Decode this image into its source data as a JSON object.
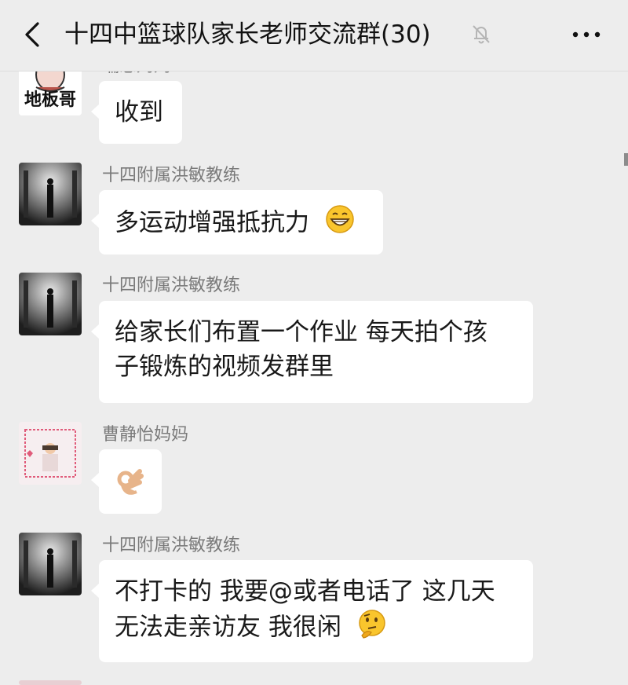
{
  "header": {
    "title": "十四中篮球队家长老师交流群(30)"
  },
  "messages": [
    {
      "sender": "瑞恩妈妈",
      "avatar_text": "地板哥",
      "text": "收到"
    },
    {
      "sender": "十四附属洪敏教练",
      "text": "多运动增强抵抗力",
      "emoji": "grinning-face-icon"
    },
    {
      "sender": "十四附属洪敏教练",
      "lines": [
        "给家长们布置一个作业 每天拍个孩",
        "子锻炼的视频发群里"
      ]
    },
    {
      "sender": "曹静怡妈妈",
      "emoji": "ok-hand-icon"
    },
    {
      "sender": "十四附属洪敏教练",
      "lines": [
        "不打卡的 我要@或者电话了 这几天",
        "无法走亲访友 我很闲"
      ],
      "emoji": "thinking-face-icon"
    }
  ],
  "colors": {
    "background": "#ededed",
    "bubble": "#ffffff",
    "sender_text": "#7a7a7a"
  }
}
